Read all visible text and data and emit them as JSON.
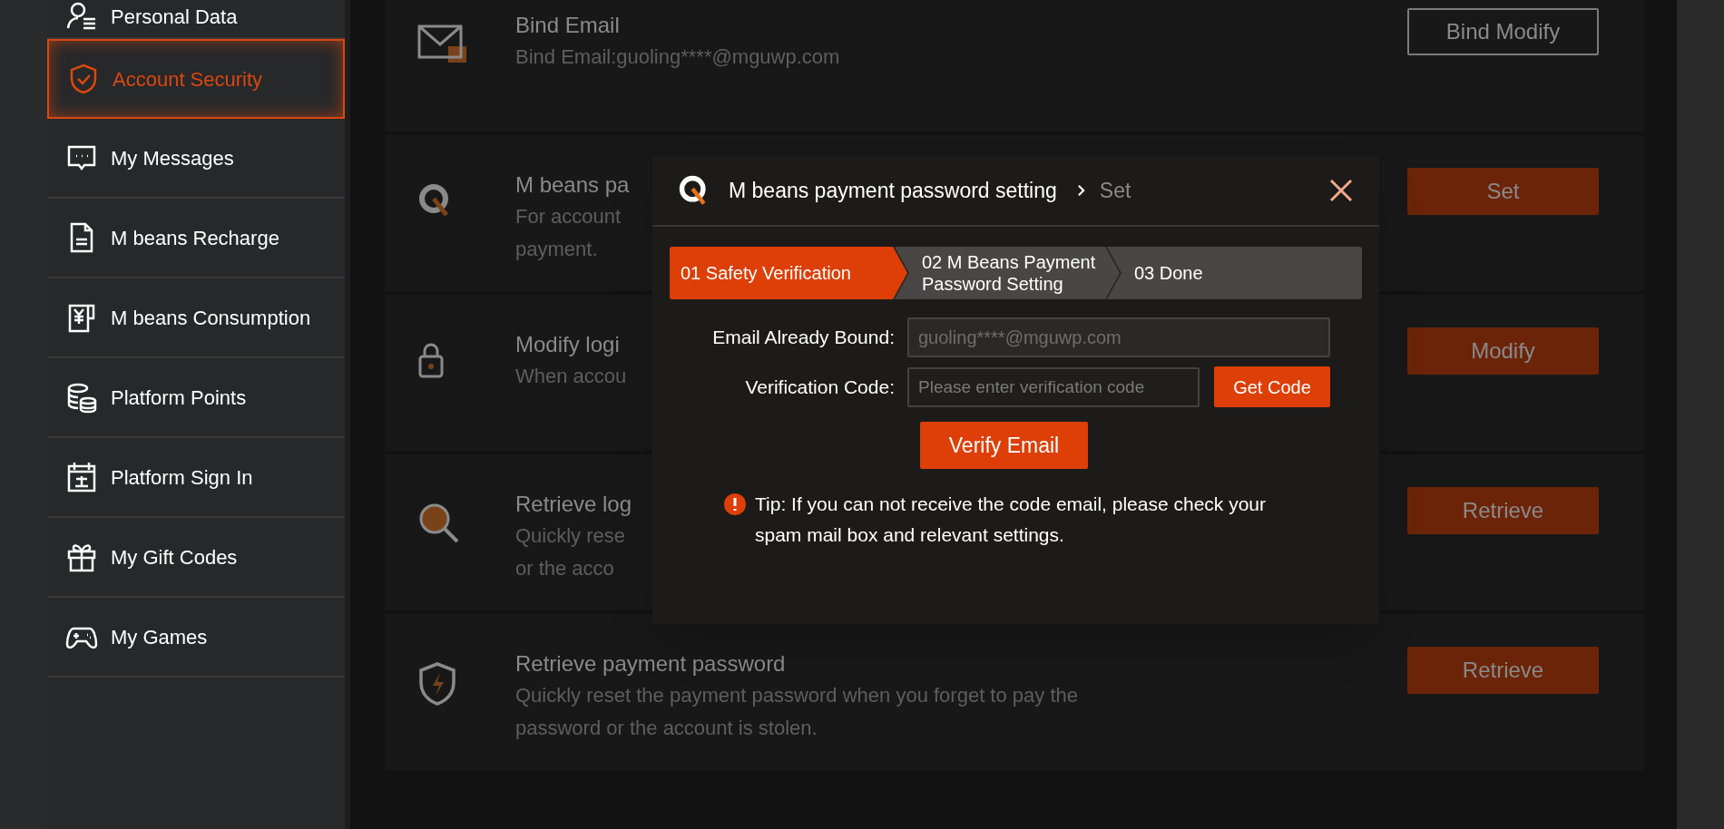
{
  "sidebar": {
    "items": [
      {
        "label": "Personal Data",
        "selected": false
      },
      {
        "label": "Account Security",
        "selected": true
      },
      {
        "label": "My Messages",
        "selected": false
      },
      {
        "label": "M beans Recharge",
        "selected": false
      },
      {
        "label": "M beans Consumption",
        "selected": false
      },
      {
        "label": "Platform Points",
        "selected": false
      },
      {
        "label": "Platform Sign In",
        "selected": false
      },
      {
        "label": "My Gift Codes",
        "selected": false
      },
      {
        "label": "My Games",
        "selected": false
      }
    ]
  },
  "cards": [
    {
      "title": "Bind Email",
      "description_lines": [
        "Bind Email:guoling****@mguwp.com"
      ],
      "button": "Bind Modify",
      "kind": "outline"
    },
    {
      "title": "M beans pa",
      "description_lines": [
        "For account",
        "payment."
      ],
      "button": "Set",
      "kind": "filled"
    },
    {
      "title": "Modify logi",
      "description_lines": [
        "When accou"
      ],
      "button": "Modify",
      "kind": "filled"
    },
    {
      "title": "Retrieve log",
      "description_lines": [
        "Quickly rese",
        "or the acco"
      ],
      "button": "Retrieve",
      "kind": "filled"
    },
    {
      "title": "Retrieve payment password",
      "description_lines": [
        "Quickly reset the payment password when you forget to pay the",
        "password or the account is stolen."
      ],
      "button": "Retrieve",
      "kind": "filled"
    }
  ],
  "dialog": {
    "title": "M beans payment password setting",
    "breadcrumb": "Set",
    "steps": [
      {
        "label": "01 Safety Verification",
        "selected": true
      },
      {
        "label": "02 M Beans Payment Password Setting",
        "selected": false
      },
      {
        "label": "03 Done",
        "selected": false
      }
    ],
    "email_field": {
      "label": "Email Already Bound:",
      "value": "guoling****@mguwp.com",
      "disabled": true
    },
    "code_field": {
      "label": "Verification Code:",
      "placeholder": "Please enter verification code"
    },
    "get_code_button": "Get Code",
    "verify_button": "Verify Email",
    "tip": "Tip: If you can not receive the code email, please check your spam mail box and relevant settings."
  }
}
